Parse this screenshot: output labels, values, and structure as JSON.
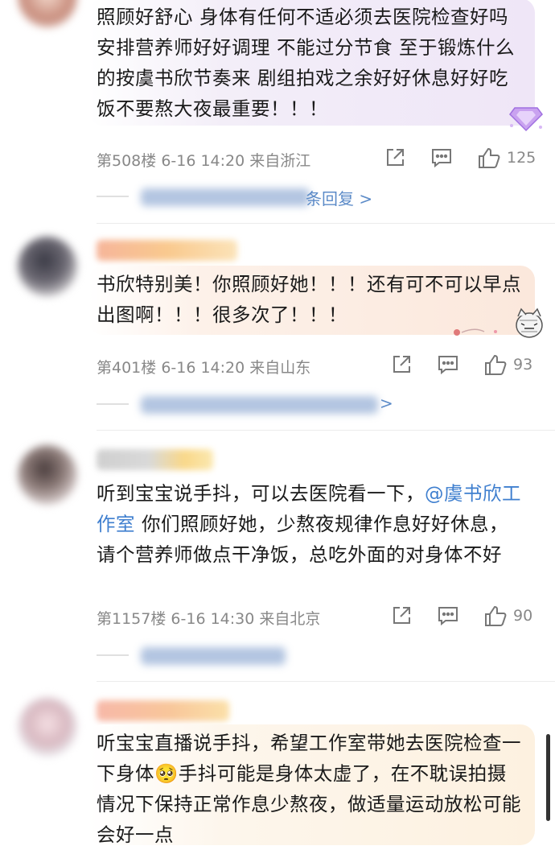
{
  "comments": [
    {
      "text": "照顾好舒心 身体有任何不适必须去医院检查好吗 安排营养师好好调理 不能过分节食 至于锻炼什么的按虞书欣节奏来 剧组拍戏之余好好休息好好吃饭不要熬大夜最重要！！！",
      "floor": "第508楼",
      "time": "6-16 14:20",
      "location": "来自浙江",
      "likes": "125",
      "reply_link": "条回复 >",
      "bubble_color": "#f3eef8"
    },
    {
      "text": "书欣特别美！你照顾好她！！！还有可不可以早点出图啊！！！很多次了！！！",
      "floor": "第401楼",
      "time": "6-16 14:20",
      "location": "来自山东",
      "likes": "93",
      "reply_link": ">",
      "bubble_color": "#fdf1e9"
    },
    {
      "text_before": "听到宝宝说手抖，可以去医院看一下，",
      "mention": "@虞书欣工作室",
      "text_after": " 你们照顾好她，少熬夜规律作息好好休息，请个营养师做点干净饭，总吃外面的对身体不好",
      "floor": "第1157楼",
      "time": "6-16 14:30",
      "location": "来自北京",
      "likes": "90"
    },
    {
      "text": "听宝宝直播说手抖，希望工作室带她去医院检查一下身体🥺手抖可能是身体太虚了，在不耽误拍摄情况下保持正常作息少熬夜，做适量运动放松可能会好一点",
      "bubble_color": "#fdf3e4"
    }
  ],
  "icons": {
    "share": "share-icon",
    "comment": "comment-icon",
    "like": "thumbs-up-icon"
  },
  "colors": {
    "meta_gray": "#888888",
    "link_blue": "#5c8bc8",
    "mention_blue": "#3f7fcf"
  }
}
